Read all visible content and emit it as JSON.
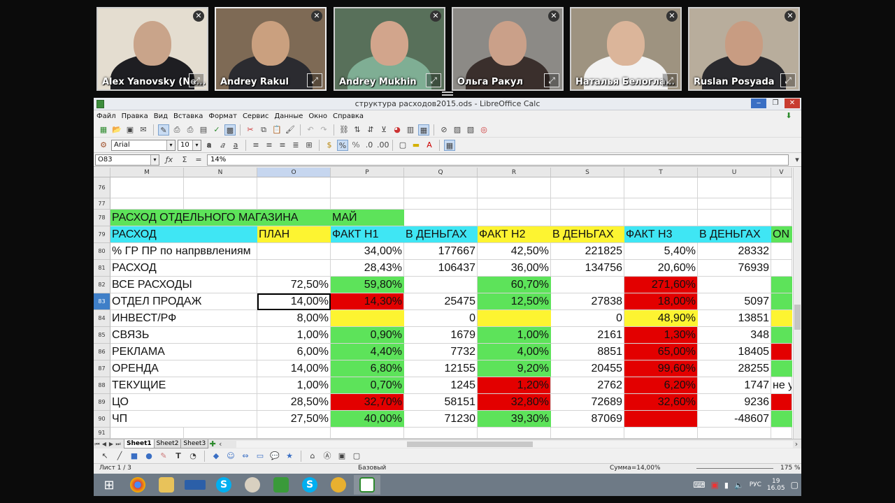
{
  "participants": [
    {
      "name": "Alex Yanovsky (Ne…",
      "bg": "#e4ddd0",
      "skin": "#c9a48a",
      "shirt": "#1e1e22"
    },
    {
      "name": "Andrey Rakul",
      "bg": "#7e6a55",
      "skin": "#caa07f",
      "shirt": "#2b2b30"
    },
    {
      "name": "Andrey Mukhin",
      "bg": "#58705a",
      "skin": "#d2a58c",
      "shirt": "#7fae94"
    },
    {
      "name": "Ольга Ракул",
      "bg": "#8c8a86",
      "skin": "#caa089",
      "shirt": "#3a2f2c"
    },
    {
      "name": "Наталья Белогла…",
      "bg": "#9e9380",
      "skin": "#dbb59a",
      "shirt": "#f2f2f2"
    },
    {
      "name": "Ruslan Posyada",
      "bg": "#b8ad9c",
      "skin": "#c89c82",
      "shirt": "#2a2a2e"
    }
  ],
  "window": {
    "title": "структура расходов2015.ods - LibreOffice Calc"
  },
  "menu": [
    "Файл",
    "Правка",
    "Вид",
    "Вставка",
    "Формат",
    "Сервис",
    "Данные",
    "Окно",
    "Справка"
  ],
  "format": {
    "font": "Arial",
    "size": "10"
  },
  "formula": {
    "cellref": "O83",
    "value": "14%"
  },
  "columns": [
    {
      "label": "M",
      "width": 105
    },
    {
      "label": "N",
      "width": 105
    },
    {
      "label": "O",
      "width": 105,
      "selected": true
    },
    {
      "label": "P",
      "width": 105
    },
    {
      "label": "Q",
      "width": 105
    },
    {
      "label": "R",
      "width": 105
    },
    {
      "label": "S",
      "width": 105
    },
    {
      "label": "T",
      "width": 105
    },
    {
      "label": "U",
      "width": 105
    },
    {
      "label": "V",
      "width": 30
    }
  ],
  "colors": {
    "green": "#5de35a",
    "cyan": "#3fe6f4",
    "yellow": "#fdf431",
    "red": "#e30000"
  },
  "rows": [
    {
      "num": "76",
      "h": 30,
      "cells": []
    },
    {
      "num": "77",
      "h": 16,
      "cells": []
    },
    {
      "num": "78",
      "h": 24,
      "cells": [
        {
          "c": 0,
          "span": 3,
          "t": "РАСХОД ОТДЕЛЬНОГО МАГАЗИНА",
          "bg": "green"
        },
        {
          "c": 3,
          "t": "МАЙ",
          "bg": "green"
        }
      ]
    },
    {
      "num": "79",
      "h": 24,
      "cells": [
        {
          "c": 0,
          "span": 2,
          "t": "РАСХОД",
          "bg": "cyan"
        },
        {
          "c": 2,
          "t": "ПЛАН",
          "bg": "yellow"
        },
        {
          "c": 3,
          "t": "ФАКТ Н1",
          "bg": "cyan"
        },
        {
          "c": 4,
          "t": "В ДЕНЬГАХ",
          "bg": "cyan"
        },
        {
          "c": 5,
          "t": "ФАКТ Н2",
          "bg": "yellow"
        },
        {
          "c": 6,
          "t": "В ДЕНЬГАХ",
          "bg": "yellow"
        },
        {
          "c": 7,
          "t": "ФАКТ Н3",
          "bg": "cyan"
        },
        {
          "c": 8,
          "t": "В ДЕНЬГАХ",
          "bg": "cyan"
        },
        {
          "c": 9,
          "t": "ОN",
          "bg": "green"
        }
      ]
    },
    {
      "num": "80",
      "h": 24,
      "cells": [
        {
          "c": 0,
          "span": 2,
          "t": "% ГР ПР по напрввлениям"
        },
        {
          "c": 3,
          "t": "34,00%",
          "r": true
        },
        {
          "c": 4,
          "t": "177667",
          "r": true
        },
        {
          "c": 5,
          "t": "42,50%",
          "r": true
        },
        {
          "c": 6,
          "t": "221825",
          "r": true
        },
        {
          "c": 7,
          "t": "5,40%",
          "r": true
        },
        {
          "c": 8,
          "t": "28332",
          "r": true
        }
      ]
    },
    {
      "num": "81",
      "h": 24,
      "cells": [
        {
          "c": 0,
          "span": 2,
          "t": "РАСХОД"
        },
        {
          "c": 3,
          "t": "28,43%",
          "r": true
        },
        {
          "c": 4,
          "t": "106437",
          "r": true
        },
        {
          "c": 5,
          "t": "36,00%",
          "r": true
        },
        {
          "c": 6,
          "t": "134756",
          "r": true
        },
        {
          "c": 7,
          "t": "20,60%",
          "r": true
        },
        {
          "c": 8,
          "t": "76939",
          "r": true
        }
      ]
    },
    {
      "num": "82",
      "h": 24,
      "cells": [
        {
          "c": 0,
          "span": 2,
          "t": "ВСЕ РАСХОДЫ"
        },
        {
          "c": 2,
          "t": "72,50%",
          "r": true
        },
        {
          "c": 3,
          "t": "59,80%",
          "r": true,
          "bg": "green"
        },
        {
          "c": 5,
          "t": "60,70%",
          "r": true,
          "bg": "green"
        },
        {
          "c": 7,
          "t": "271,60%",
          "r": true,
          "bg": "red"
        },
        {
          "c": 9,
          "t": "",
          "bg": "green"
        }
      ]
    },
    {
      "num": "83",
      "h": 24,
      "selected": true,
      "cells": [
        {
          "c": 0,
          "span": 2,
          "t": "ОТДЕЛ ПРОДАЖ"
        },
        {
          "c": 2,
          "t": "14,00%",
          "r": true,
          "sel": true
        },
        {
          "c": 3,
          "t": "14,30%",
          "r": true,
          "bg": "red"
        },
        {
          "c": 4,
          "t": "25475",
          "r": true
        },
        {
          "c": 5,
          "t": "12,50%",
          "r": true,
          "bg": "green"
        },
        {
          "c": 6,
          "t": "27838",
          "r": true
        },
        {
          "c": 7,
          "t": "18,00%",
          "r": true,
          "bg": "red"
        },
        {
          "c": 8,
          "t": "5097",
          "r": true
        },
        {
          "c": 9,
          "t": "",
          "bg": "green"
        }
      ]
    },
    {
      "num": "84",
      "h": 24,
      "cells": [
        {
          "c": 0,
          "span": 2,
          "t": "ИНВЕСТ/РФ"
        },
        {
          "c": 2,
          "t": "8,00%",
          "r": true
        },
        {
          "c": 3,
          "t": "",
          "bg": "yellow"
        },
        {
          "c": 4,
          "t": "0",
          "r": true
        },
        {
          "c": 5,
          "t": "",
          "bg": "yellow"
        },
        {
          "c": 6,
          "t": "0",
          "r": true
        },
        {
          "c": 7,
          "t": "48,90%",
          "r": true,
          "bg": "yellow"
        },
        {
          "c": 8,
          "t": "13851",
          "r": true
        },
        {
          "c": 9,
          "t": "",
          "bg": "yellow"
        }
      ]
    },
    {
      "num": "85",
      "h": 24,
      "cells": [
        {
          "c": 0,
          "span": 2,
          "t": "СВЯЗЬ"
        },
        {
          "c": 2,
          "t": "1,00%",
          "r": true
        },
        {
          "c": 3,
          "t": "0,90%",
          "r": true,
          "bg": "green"
        },
        {
          "c": 4,
          "t": "1679",
          "r": true
        },
        {
          "c": 5,
          "t": "1,00%",
          "r": true,
          "bg": "green"
        },
        {
          "c": 6,
          "t": "2161",
          "r": true
        },
        {
          "c": 7,
          "t": "1,30%",
          "r": true,
          "bg": "red"
        },
        {
          "c": 8,
          "t": "348",
          "r": true
        },
        {
          "c": 9,
          "t": "",
          "bg": "green"
        }
      ]
    },
    {
      "num": "86",
      "h": 24,
      "cells": [
        {
          "c": 0,
          "span": 2,
          "t": "РЕКЛАМА"
        },
        {
          "c": 2,
          "t": "6,00%",
          "r": true
        },
        {
          "c": 3,
          "t": "4,40%",
          "r": true,
          "bg": "green"
        },
        {
          "c": 4,
          "t": "7732",
          "r": true
        },
        {
          "c": 5,
          "t": "4,00%",
          "r": true,
          "bg": "green"
        },
        {
          "c": 6,
          "t": "8851",
          "r": true
        },
        {
          "c": 7,
          "t": "65,00%",
          "r": true,
          "bg": "red"
        },
        {
          "c": 8,
          "t": "18405",
          "r": true
        },
        {
          "c": 9,
          "t": "",
          "bg": "red"
        }
      ]
    },
    {
      "num": "87",
      "h": 24,
      "cells": [
        {
          "c": 0,
          "span": 2,
          "t": "ОРЕНДА"
        },
        {
          "c": 2,
          "t": "14,00%",
          "r": true
        },
        {
          "c": 3,
          "t": "6,80%",
          "r": true,
          "bg": "green"
        },
        {
          "c": 4,
          "t": "12155",
          "r": true
        },
        {
          "c": 5,
          "t": "9,20%",
          "r": true,
          "bg": "green"
        },
        {
          "c": 6,
          "t": "20455",
          "r": true
        },
        {
          "c": 7,
          "t": "99,60%",
          "r": true,
          "bg": "red"
        },
        {
          "c": 8,
          "t": "28255",
          "r": true
        },
        {
          "c": 9,
          "t": "",
          "bg": "green"
        }
      ]
    },
    {
      "num": "88",
      "h": 24,
      "cells": [
        {
          "c": 0,
          "span": 2,
          "t": "ТЕКУЩИЕ"
        },
        {
          "c": 2,
          "t": "1,00%",
          "r": true
        },
        {
          "c": 3,
          "t": "0,70%",
          "r": true,
          "bg": "green"
        },
        {
          "c": 4,
          "t": "1245",
          "r": true
        },
        {
          "c": 5,
          "t": "1,20%",
          "r": true,
          "bg": "red"
        },
        {
          "c": 6,
          "t": "2762",
          "r": true
        },
        {
          "c": 7,
          "t": "6,20%",
          "r": true,
          "bg": "red"
        },
        {
          "c": 8,
          "t": "1747",
          "r": true
        },
        {
          "c": 9,
          "t": "не у"
        }
      ]
    },
    {
      "num": "89",
      "h": 24,
      "cells": [
        {
          "c": 0,
          "span": 2,
          "t": "ЦО"
        },
        {
          "c": 2,
          "t": "28,50%",
          "r": true
        },
        {
          "c": 3,
          "t": "32,70%",
          "r": true,
          "bg": "red"
        },
        {
          "c": 4,
          "t": "58151",
          "r": true
        },
        {
          "c": 5,
          "t": "32,80%",
          "r": true,
          "bg": "red"
        },
        {
          "c": 6,
          "t": "72689",
          "r": true
        },
        {
          "c": 7,
          "t": "32,60%",
          "r": true,
          "bg": "red"
        },
        {
          "c": 8,
          "t": "9236",
          "r": true
        },
        {
          "c": 9,
          "t": "",
          "bg": "red"
        }
      ]
    },
    {
      "num": "90",
      "h": 24,
      "cells": [
        {
          "c": 0,
          "span": 2,
          "t": "ЧП"
        },
        {
          "c": 2,
          "t": "27,50%",
          "r": true
        },
        {
          "c": 3,
          "t": "40,00%",
          "r": true,
          "bg": "green"
        },
        {
          "c": 4,
          "t": "71230",
          "r": true
        },
        {
          "c": 5,
          "t": "39,30%",
          "r": true,
          "bg": "green"
        },
        {
          "c": 6,
          "t": "87069",
          "r": true
        },
        {
          "c": 7,
          "t": "",
          "bg": "red"
        },
        {
          "c": 8,
          "t": "-48607",
          "r": true
        },
        {
          "c": 9,
          "t": "",
          "bg": "green"
        }
      ]
    },
    {
      "num": "91",
      "h": 16,
      "cells": []
    }
  ],
  "sheets": [
    "Sheet1",
    "Sheet2",
    "Sheet3"
  ],
  "status": {
    "sheet": "Лист 1 / 3",
    "style": "Базовый",
    "sum": "Сумма=14,00%",
    "zoom": "175 %"
  },
  "tray": {
    "lang": "РУС",
    "time": "19",
    "date": "16.05"
  }
}
